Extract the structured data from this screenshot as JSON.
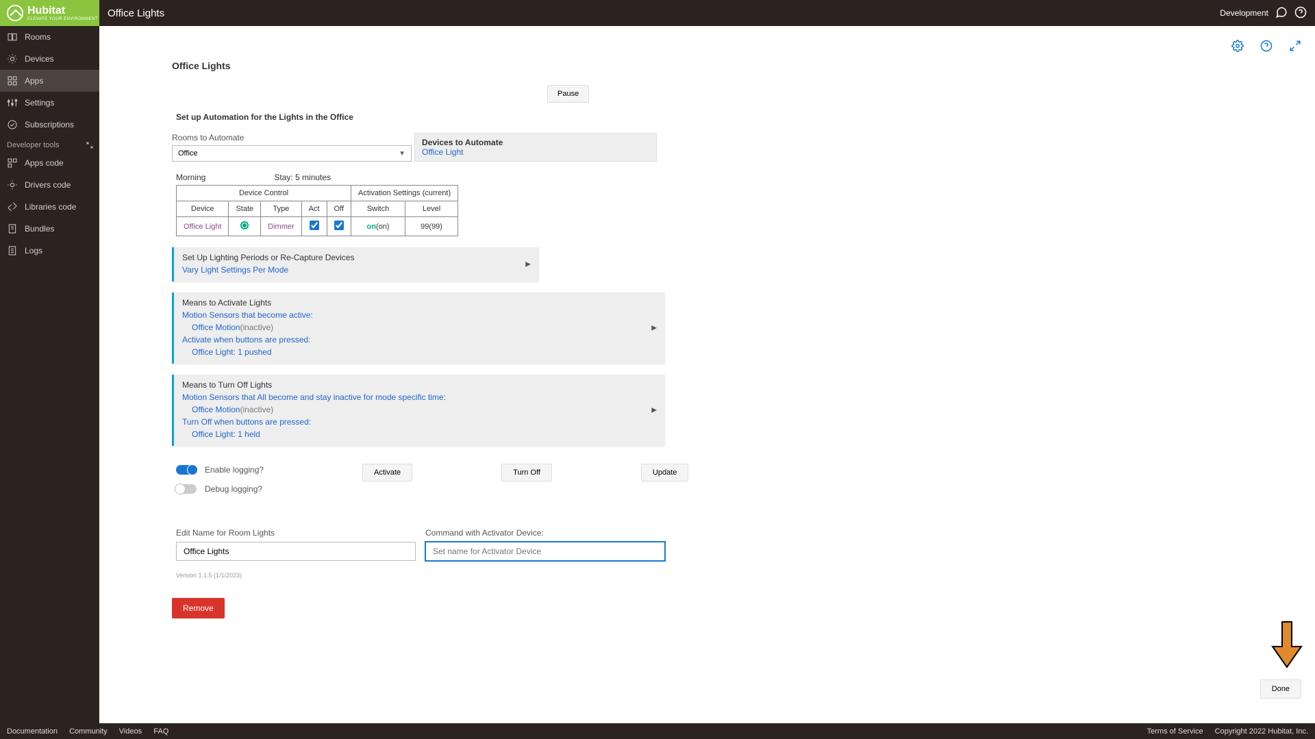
{
  "header": {
    "brand": "Hubitat",
    "tagline": "ELEVATE YOUR ENVIRONMENT",
    "page_title": "Office Lights",
    "dev_label": "Development"
  },
  "sidebar": {
    "items": [
      {
        "label": "Rooms"
      },
      {
        "label": "Devices"
      },
      {
        "label": "Apps"
      },
      {
        "label": "Settings"
      },
      {
        "label": "Subscriptions"
      }
    ],
    "dev_section": "Developer tools",
    "dev_items": [
      {
        "label": "Apps code"
      },
      {
        "label": "Drivers code"
      },
      {
        "label": "Libraries code"
      },
      {
        "label": "Bundles"
      },
      {
        "label": "Logs"
      }
    ]
  },
  "main": {
    "title": "Office Lights",
    "pause": "Pause",
    "setup_text": "Set up Automation for the Lights in the Office",
    "rooms_label": "Rooms to Automate",
    "rooms_value": "Office",
    "devices_label": "Devices to Automate",
    "devices_link": "Office Light",
    "morning": "Morning",
    "stay": "Stay: 5 minutes",
    "table": {
      "group1": "Device Control",
      "group2": "Activation Settings (current)",
      "h_device": "Device",
      "h_state": "State",
      "h_type": "Type",
      "h_act": "Act",
      "h_off": "Off",
      "h_switch": "Switch",
      "h_level": "Level",
      "r_device": "Office Light",
      "r_type": "Dimmer",
      "r_switch_on": "on",
      "r_switch_paren": "(on)",
      "r_level": "99",
      "r_level_paren": "(99)"
    },
    "panel1": {
      "title": "Set Up Lighting Periods or Re-Capture Devices",
      "link": "Vary Light Settings Per Mode"
    },
    "panel2": {
      "title": "Means to Activate Lights",
      "l1": "Motion Sensors that become active:",
      "l1a": "Office Motion",
      "l1b": "(inactive)",
      "l2": "Activate when buttons are pressed:",
      "l2a": "Office Light: 1 pushed"
    },
    "panel3": {
      "title": "Means to Turn Off Lights",
      "l1": "Motion Sensors that All become and stay inactive for mode specific time:",
      "l1a": "Office Motion",
      "l1b": "(inactive)",
      "l2": "Turn Off when buttons are pressed:",
      "l2a": "Office Light: 1 held"
    },
    "enable_logging": "Enable logging?",
    "debug_logging": "Debug logging?",
    "activate": "Activate",
    "turnoff": "Turn Off",
    "update": "Update",
    "edit_name_label": "Edit Name for Room Lights",
    "edit_name_value": "Office Lights",
    "activator_label": "Command with Activator Device:",
    "activator_placeholder": "Set name for Activator Device",
    "version": "Version 1.1.5 (1/1/2023)",
    "remove": "Remove",
    "done": "Done"
  },
  "footer": {
    "left": [
      "Documentation",
      "Community",
      "Videos",
      "FAQ"
    ],
    "terms": "Terms of Service",
    "copyright": "Copyright 2022 Hubitat, Inc."
  }
}
